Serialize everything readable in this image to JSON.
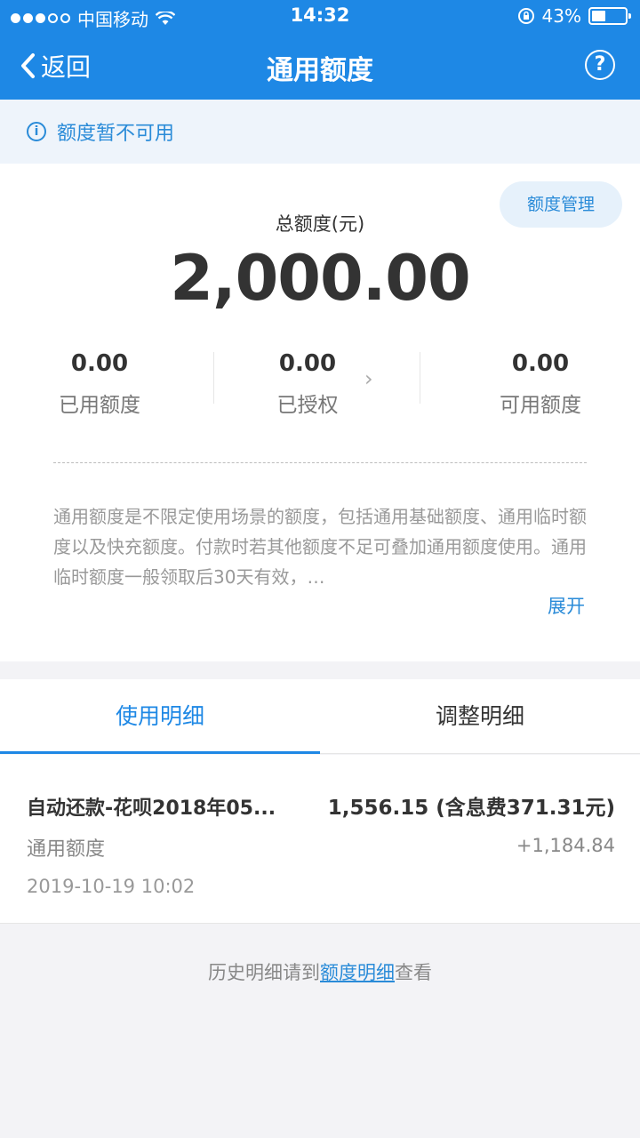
{
  "status_bar": {
    "carrier": "中国移动",
    "time": "14:32",
    "battery_percent": "43%",
    "battery_level": 0.43
  },
  "nav": {
    "back_label": "返回",
    "title": "通用额度",
    "help_label": "?"
  },
  "notice": {
    "icon_label": "i",
    "text": "额度暂不可用"
  },
  "card": {
    "manage_button": "额度管理",
    "total_label": "总额度(元)",
    "total_value": "2,000.00",
    "stats": [
      {
        "value": "0.00",
        "label": "已用额度"
      },
      {
        "value": "0.00",
        "label": "已授权"
      },
      {
        "value": "0.00",
        "label": "可用额度"
      }
    ],
    "stat_chevron": "›",
    "description": "通用额度是不限定使用场景的额度，包括通用基础额度、通用临时额度以及快充额度。付款时若其他额度不足可叠加通用额度使用。通用临时额度一般领取后30天有效，…",
    "expand_label": "展开"
  },
  "tabs": [
    {
      "label": "使用明细",
      "active": true
    },
    {
      "label": "调整明细",
      "active": false
    }
  ],
  "record": {
    "title": "自动还款-花呗2018年05...",
    "amount": "1,556.15 (含息费371.31元)",
    "type": "通用额度",
    "delta": "+1,184.84",
    "time": "2019-10-19 10:02"
  },
  "history": {
    "prefix": "历史明细请到",
    "link": "额度明细",
    "suffix": "查看"
  },
  "colors": {
    "accent": "#1e88e5",
    "link": "#2a8bd8",
    "notice_bg": "#eef4fb"
  }
}
